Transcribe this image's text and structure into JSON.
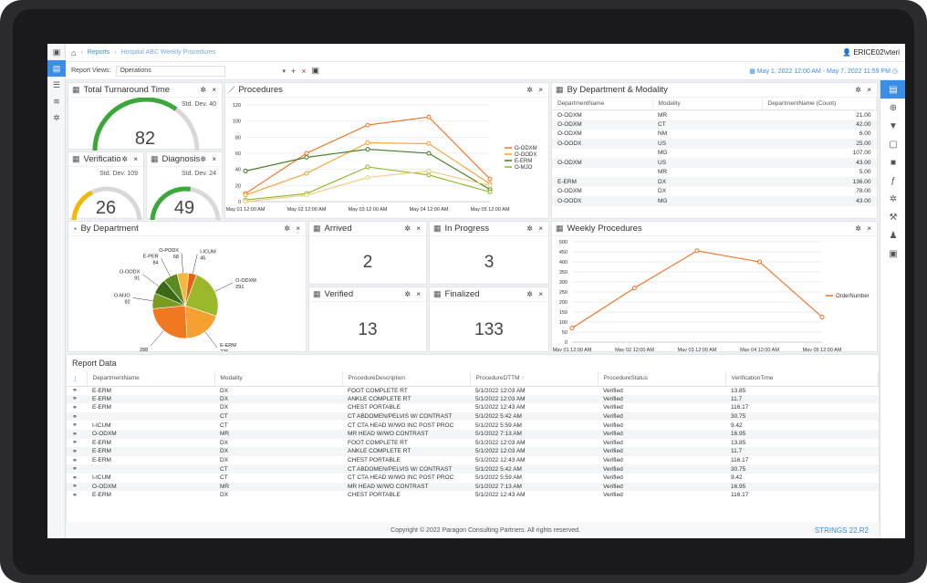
{
  "breadcrumb": {
    "reports": "Reports",
    "current": "Hospital ABC Weekly Procedures"
  },
  "user": "ERICE02\\vteri",
  "viewbar": {
    "label": "Report Views:",
    "selected": "Operations",
    "dates": "May 1, 2022 12:00 AM - May 7, 2022 11:59 PM"
  },
  "tat": {
    "title": "Total Turnaround Time",
    "stddev": "Std. Dev. 40",
    "value": "82",
    "fraction": 0.7,
    "color": "#3aa83a"
  },
  "verif": {
    "title": "Verificatio",
    "stddev": "Std. Dev. 109",
    "value": "26",
    "fraction": 0.35,
    "color": "#f5b800"
  },
  "diag": {
    "title": "Diagnosis",
    "stddev": "Std. Dev. 24",
    "value": "49",
    "fraction": 0.55,
    "color": "#3aa83a"
  },
  "procedures": {
    "title": "Procedures"
  },
  "bydm": {
    "title": "By Department & Modality",
    "headers": [
      "DepartmentName",
      "Modality",
      "DepartmentName (Count)"
    ],
    "rows": [
      [
        "O-ODXM",
        "MR",
        "21.00"
      ],
      [
        "O-ODXM",
        "CT",
        "42.00"
      ],
      [
        "O-ODXM",
        "NM",
        "6.00"
      ],
      [
        "O-OODX",
        "US",
        "25.00"
      ],
      [
        "",
        "MG",
        "107.00"
      ],
      [
        "O-ODXM",
        "US",
        "43.00"
      ],
      [
        "",
        "MR",
        "5.00"
      ],
      [
        "E-ERM",
        "DX",
        "136.00"
      ],
      [
        "O-ODXM",
        "DX",
        "78.00"
      ],
      [
        "O-OODX",
        "MG",
        "43.00"
      ]
    ]
  },
  "bydept": {
    "title": "By Department"
  },
  "arrived": {
    "title": "Arrived",
    "value": "2"
  },
  "inprogress": {
    "title": "In Progress",
    "value": "3"
  },
  "verified": {
    "title": "Verified",
    "value": "13"
  },
  "finalized": {
    "title": "Finalized",
    "value": "133"
  },
  "weekly": {
    "title": "Weekly Procedures"
  },
  "report": {
    "title": "Report Data",
    "headers": [
      "DepartmentName",
      "Modality",
      "ProcedureDescription",
      "ProcedureDTTM",
      "ProcedureStatus",
      "VerificationTime"
    ],
    "sort_arrow": "↑",
    "rows": [
      [
        "E-ERM",
        "DX",
        "FOOT COMPLETE RT",
        "5/1/2022 12:03 AM",
        "Verified",
        "13.85"
      ],
      [
        "E-ERM",
        "DX",
        "ANKLE COMPLETE RT",
        "5/1/2022 12:03 AM",
        "Verified",
        "11.7"
      ],
      [
        "E-ERM",
        "DX",
        "CHEST PORTABLE",
        "5/1/2022 12:43 AM",
        "Verified",
        "116.17"
      ],
      [
        "",
        "CT",
        "CT ABDOMEN/PELVIS W/ CONTRAST",
        "5/1/2022 5:42 AM",
        "Verified",
        "30.75"
      ],
      [
        "I-ICUM",
        "CT",
        "CT CTA HEAD W/WO INC POST PROC",
        "5/1/2022 5:59 AM",
        "Verified",
        "9.42"
      ],
      [
        "O-ODXM",
        "MR",
        "MR HEAD W/WO CONTRAST",
        "5/1/2022 7:13 AM",
        "Verified",
        "16.95"
      ],
      [
        "E-ERM",
        "DX",
        "FOOT COMPLETE RT",
        "5/1/2022 12:03 AM",
        "Verified",
        "13.85"
      ],
      [
        "E-ERM",
        "DX",
        "ANKLE COMPLETE RT",
        "5/1/2022 12:03 AM",
        "Verified",
        "11.7"
      ],
      [
        "E-ERM",
        "DX",
        "CHEST PORTABLE",
        "5/1/2022 12:43 AM",
        "Verified",
        "116.17"
      ],
      [
        "",
        "CT",
        "CT ABDOMEN/PELVIS W/ CONTRAST",
        "5/1/2022 5:42 AM",
        "Verified",
        "30.75"
      ],
      [
        "I-ICUM",
        "CT",
        "CT CTA HEAD W/WO INC POST PROC",
        "5/1/2022 5:59 AM",
        "Verified",
        "9.42"
      ],
      [
        "O-ODXM",
        "MR",
        "MR HEAD W/WO CONTRAST",
        "5/1/2022 7:13 AM",
        "Verified",
        "16.95"
      ],
      [
        "E-ERM",
        "DX",
        "CHEST PORTABLE",
        "5/1/2022 12:43 AM",
        "Verified",
        "116.17"
      ]
    ]
  },
  "footer": {
    "copyright": "Copyright © 2022 Paragon Consulting Partners. All rights reserved.",
    "brand": "STRINGS",
    "version": "22.R2"
  },
  "chart_data": [
    {
      "type": "line",
      "x": [
        "May 01 12:00 AM",
        "May 02 12:00 AM",
        "May 03 12:00 AM",
        "May 04 12:00 AM",
        "May 05 12:00 AM"
      ],
      "ylim": [
        0,
        120
      ],
      "yticks": [
        0,
        20,
        40,
        60,
        80,
        100,
        120
      ],
      "series": [
        {
          "name": "O-ODXM",
          "color": "#f07020",
          "values": [
            10,
            60,
            95,
            105,
            28
          ]
        },
        {
          "name": "O-OODX",
          "color": "#f5a030",
          "values": [
            8,
            35,
            73,
            72,
            22
          ]
        },
        {
          "name": "E-ERM",
          "color": "#3a7a1a",
          "values": [
            38,
            55,
            65,
            60,
            15
          ]
        },
        {
          "name": "O-MJO",
          "color": "#8bb820",
          "values": [
            2,
            10,
            43,
            33,
            12
          ]
        },
        {
          "name": "",
          "color": "#f5c880",
          "values": [
            0,
            8,
            30,
            38,
            20
          ]
        }
      ]
    },
    {
      "type": "pie",
      "slices": [
        {
          "label": "O-ODXM",
          "value": 291,
          "color": "#9ab82a"
        },
        {
          "label": "E-ERM",
          "value": 225,
          "color": "#f5a030"
        },
        {
          "label": "",
          "value": 288,
          "color": "#f07820"
        },
        {
          "label": "O-MJO",
          "value": 92,
          "color": "#7a9a20"
        },
        {
          "label": "O-OODX",
          "value": 91,
          "color": "#3a6a18"
        },
        {
          "label": "E-PER",
          "value": 84,
          "color": "#5a8a20"
        },
        {
          "label": "O-PODX",
          "value": 68,
          "color": "#f5b840"
        },
        {
          "label": "I-ICUM",
          "value": 45,
          "color": "#e86010"
        }
      ]
    },
    {
      "type": "line",
      "x": [
        "May 01 12:00 AM",
        "May 02 12:00 AM",
        "May 03 12:00 AM",
        "May 04 12:00 AM",
        "May 05 12:00 AM"
      ],
      "ylim": [
        0,
        500
      ],
      "yticks": [
        0,
        50,
        100,
        150,
        200,
        250,
        300,
        350,
        400,
        450,
        500
      ],
      "series": [
        {
          "name": "OrderNumber",
          "color": "#f07020",
          "values": [
            70,
            270,
            455,
            400,
            125
          ]
        }
      ]
    }
  ]
}
